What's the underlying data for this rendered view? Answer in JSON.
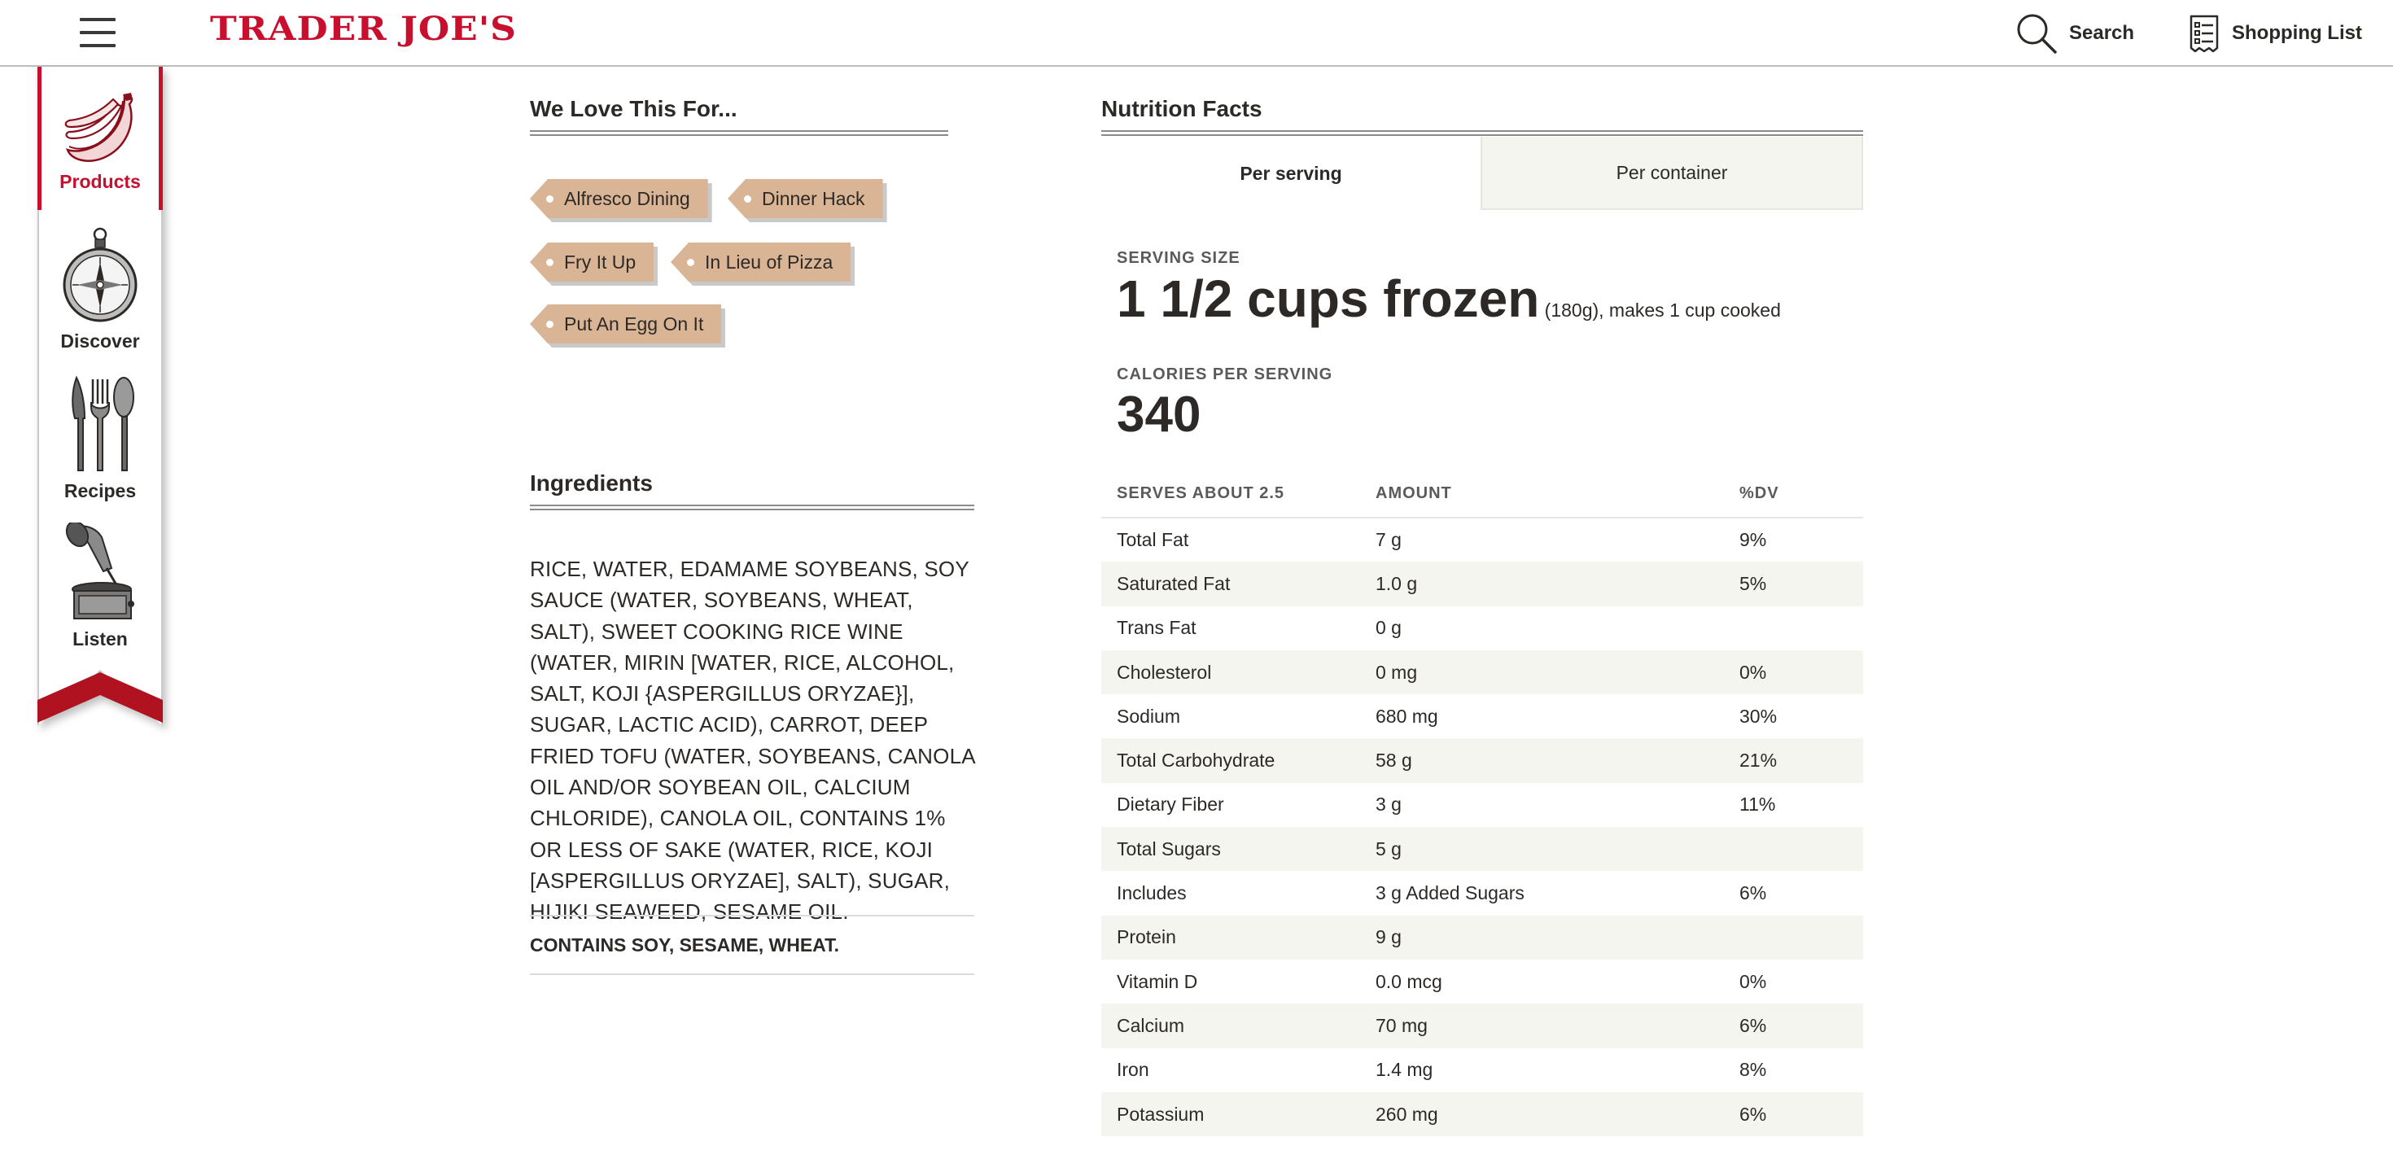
{
  "header": {
    "logo": "TRADER JOE'S",
    "search_label": "Search",
    "shopping_list_label": "Shopping List"
  },
  "sidenav": {
    "items": [
      {
        "label": "Products",
        "icon": "bananas-icon",
        "active": true
      },
      {
        "label": "Discover",
        "icon": "compass-icon",
        "active": false
      },
      {
        "label": "Recipes",
        "icon": "utensils-icon",
        "active": false
      },
      {
        "label": "Listen",
        "icon": "gramophone-icon",
        "active": false
      }
    ]
  },
  "love": {
    "title": "We Love This For...",
    "tags": [
      "Alfresco Dining",
      "Dinner Hack",
      "Fry It Up",
      "In Lieu of Pizza",
      "Put An Egg On It"
    ]
  },
  "ingredients": {
    "title": "Ingredients",
    "text": "RICE, WATER, EDAMAME SOYBEANS, SOY SAUCE (WATER, SOYBEANS, WHEAT, SALT), SWEET COOKING RICE WINE (WATER, MIRIN [WATER, RICE, ALCOHOL, SALT, KOJI {ASPERGILLUS ORYZAE}], SUGAR, LACTIC ACID), CARROT, DEEP FRIED TOFU (WATER, SOYBEANS, CANOLA OIL AND/OR SOYBEAN OIL, CALCIUM CHLORIDE), CANOLA OIL, CONTAINS 1% OR LESS OF SAKE (WATER, RICE, KOJI [ASPERGILLUS ORYZAE], SALT), SUGAR, HIJIKI SEAWEED, SESAME OIL.",
    "contains": "CONTAINS SOY, SESAME, WHEAT."
  },
  "nutrition": {
    "title": "Nutrition Facts",
    "tabs": [
      "Per serving",
      "Per container"
    ],
    "serving_size_label": "SERVING SIZE",
    "serving_size_main": "1 1/2 cups frozen",
    "serving_size_detail": " (180g), makes 1 cup cooked",
    "calories_label": "CALORIES PER SERVING",
    "calories": "340",
    "columns": [
      "SERVES ABOUT 2.5",
      "AMOUNT",
      "%DV"
    ],
    "rows": [
      {
        "name": "Total Fat",
        "amount": "7 g",
        "dv": "9%"
      },
      {
        "name": "Saturated Fat",
        "amount": "1.0 g",
        "dv": "5%"
      },
      {
        "name": "Trans Fat",
        "amount": "0 g",
        "dv": ""
      },
      {
        "name": "Cholesterol",
        "amount": "0 mg",
        "dv": "0%"
      },
      {
        "name": "Sodium",
        "amount": "680 mg",
        "dv": "30%"
      },
      {
        "name": "Total Carbohydrate",
        "amount": "58 g",
        "dv": "21%"
      },
      {
        "name": "Dietary Fiber",
        "amount": "3 g",
        "dv": "11%"
      },
      {
        "name": "Total Sugars",
        "amount": "5 g",
        "dv": ""
      },
      {
        "name": "Includes",
        "amount": "3 g Added Sugars",
        "dv": "6%"
      },
      {
        "name": "Protein",
        "amount": "9 g",
        "dv": ""
      },
      {
        "name": "Vitamin D",
        "amount": "0.0 mcg",
        "dv": "0%"
      },
      {
        "name": "Calcium",
        "amount": "70 mg",
        "dv": "6%"
      },
      {
        "name": "Iron",
        "amount": "1.4 mg",
        "dv": "8%"
      },
      {
        "name": "Potassium",
        "amount": "260 mg",
        "dv": "6%"
      }
    ]
  },
  "colors": {
    "brand_red": "#c8102e",
    "tag_tan": "#d9b596",
    "row_shade": "#f5f5f0"
  }
}
